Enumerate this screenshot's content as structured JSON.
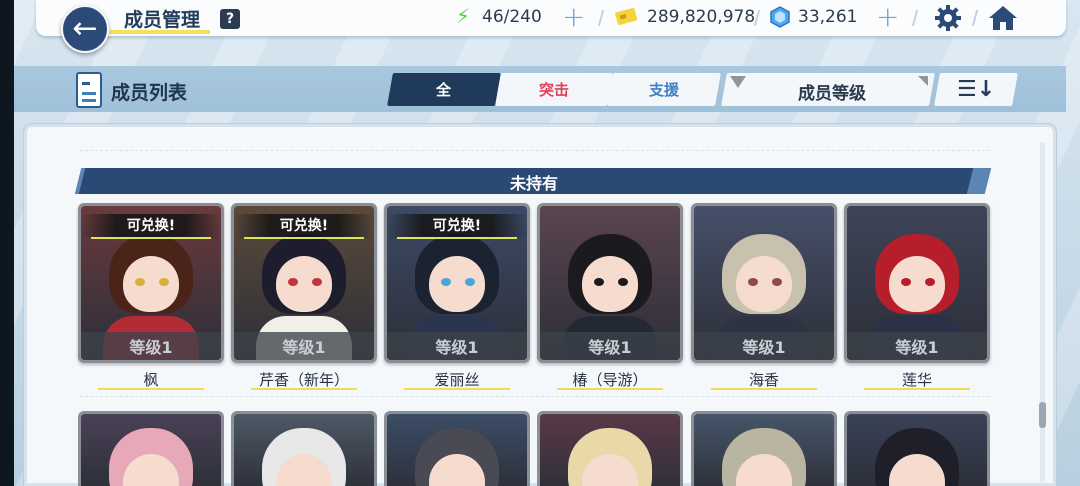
{
  "header": {
    "title": "成员管理",
    "help": "?",
    "stamina": "46/240",
    "credits": "289,820,978",
    "gems": "33,261"
  },
  "subheader": {
    "list_title": "成员列表",
    "tabs": [
      {
        "label": "全",
        "active": true
      },
      {
        "label": "突击",
        "active": false
      },
      {
        "label": "支援",
        "active": false
      }
    ],
    "sort_label": "成员等级",
    "order_icon": "☰↓"
  },
  "section": {
    "label": "未持有"
  },
  "students": [
    {
      "name": "枫",
      "level": "等级1",
      "exchange": "可兑换!",
      "palette": {
        "bg": "#6a3a3e",
        "hair": "#4a2418",
        "body": "#b22c36",
        "eye": "#d7b13a"
      }
    },
    {
      "name": "芹香（新年）",
      "level": "等级1",
      "exchange": "可兑换!",
      "palette": {
        "bg": "#5c4a3a",
        "hair": "#1d1d2e",
        "body": "#f2efe9",
        "eye": "#c2343c"
      }
    },
    {
      "name": "爱丽丝",
      "level": "等级1",
      "exchange": "可兑换!",
      "palette": {
        "bg": "#3c4a66",
        "hair": "#1b2232",
        "body": "#2a3550",
        "eye": "#4aa6d8"
      }
    },
    {
      "name": "椿（导游）",
      "level": "等级1",
      "exchange": "",
      "palette": {
        "bg": "#5a4450",
        "hair": "#1a1a1f",
        "body": "#232833",
        "eye": "#1a1a1f"
      }
    },
    {
      "name": "海香",
      "level": "等级1",
      "exchange": "",
      "palette": {
        "bg": "#47506a",
        "hair": "#c7c1ae",
        "body": "#2e3344",
        "eye": "#8e4a54"
      }
    },
    {
      "name": "莲华",
      "level": "等级1",
      "exchange": "",
      "palette": {
        "bg": "#3e4458",
        "hair": "#b51e2a",
        "body": "#2b3248",
        "eye": "#b51e2a"
      }
    }
  ],
  "next_row_palettes": [
    {
      "bg": "#4a4156",
      "hair": "#e7a8b8"
    },
    {
      "bg": "#4e5866",
      "hair": "#e8e8e8"
    },
    {
      "bg": "#3c4d66",
      "hair": "#4a4a55"
    },
    {
      "bg": "#5a3848",
      "hair": "#e9d9a8"
    },
    {
      "bg": "#46566a",
      "hair": "#b9b5a0"
    },
    {
      "bg": "#3a4258",
      "hair": "#1f1f2a"
    }
  ]
}
